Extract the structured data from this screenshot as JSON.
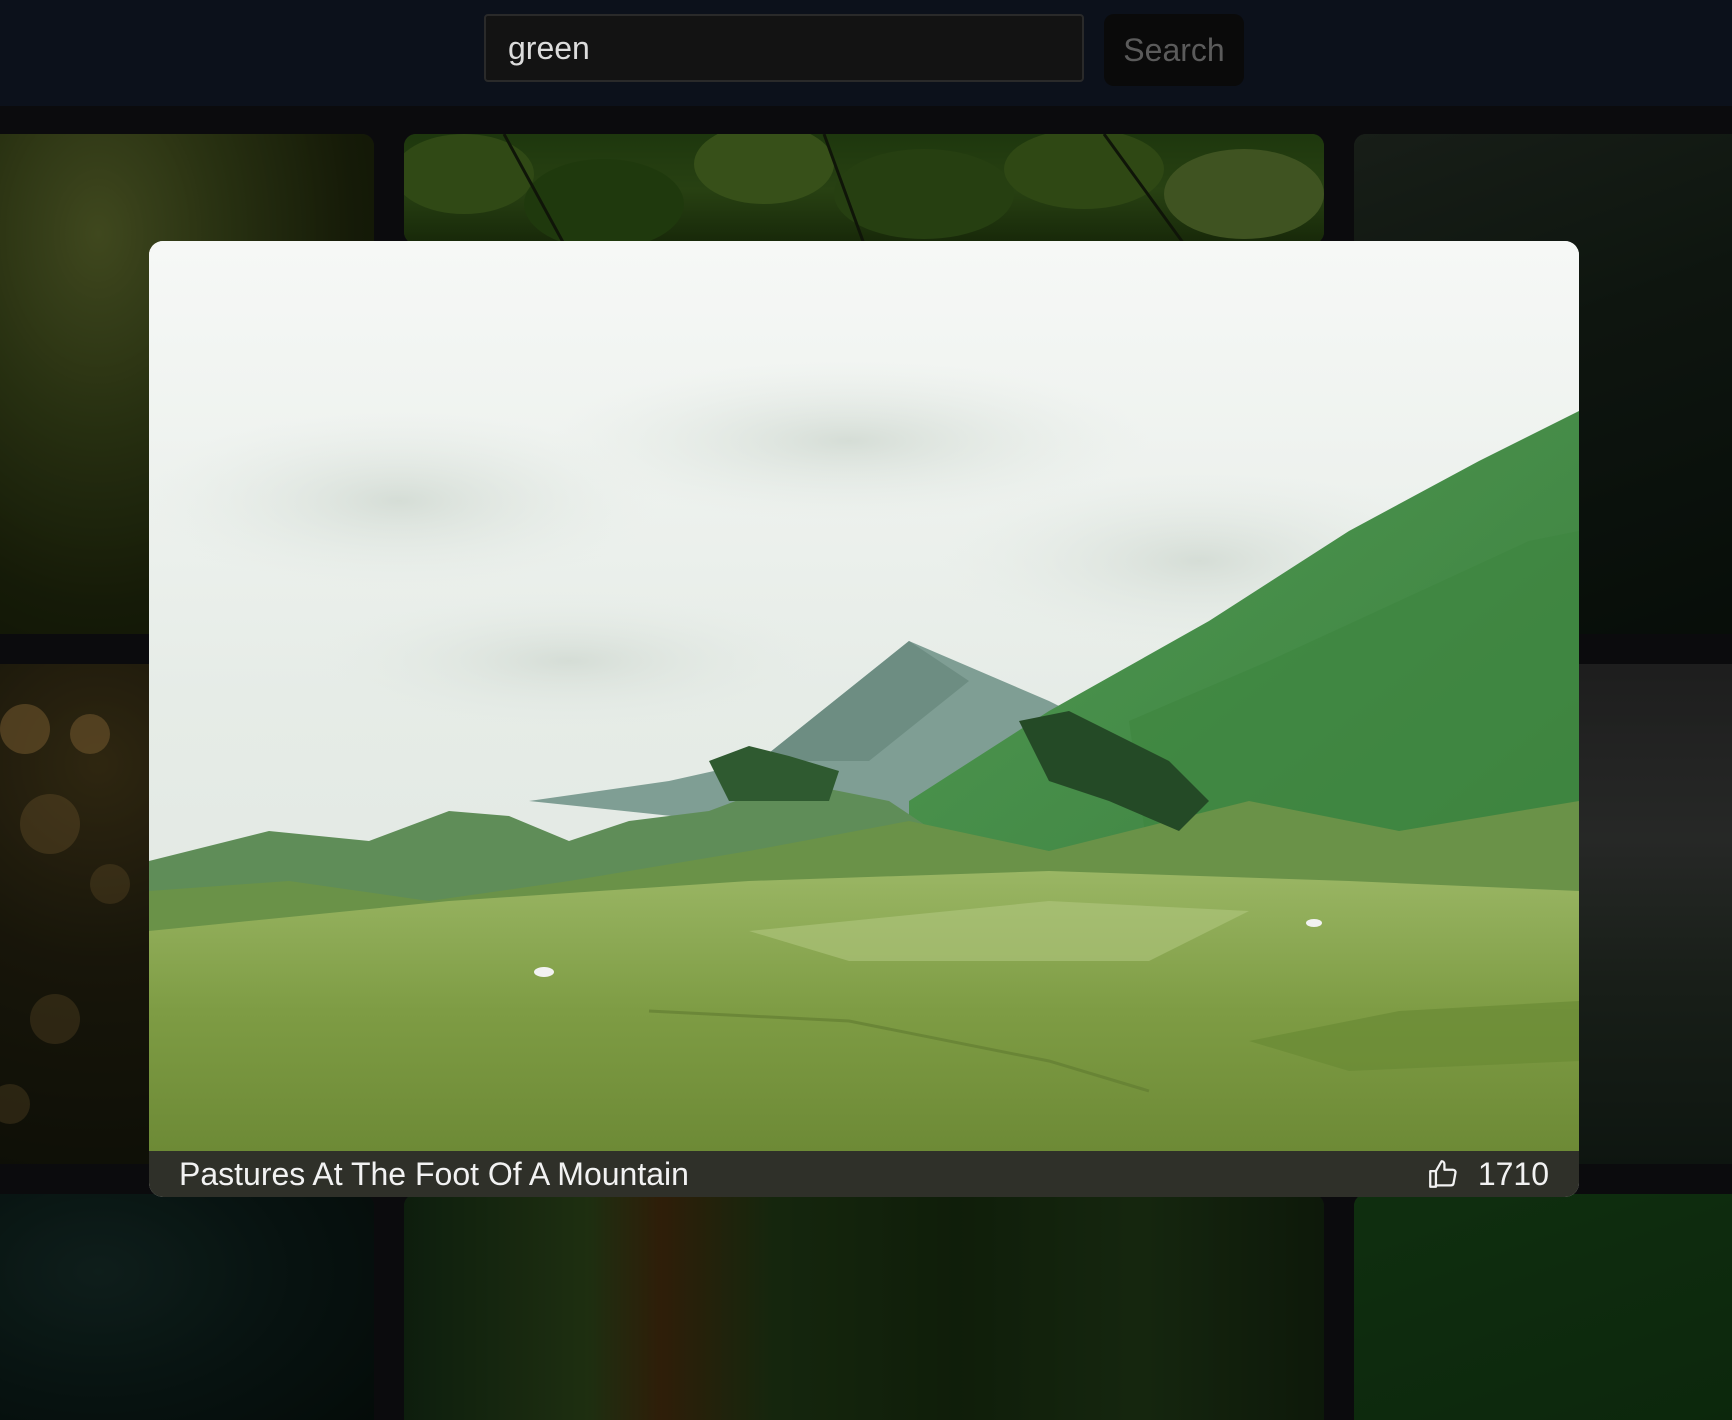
{
  "search": {
    "value": "green",
    "button_label": "Search"
  },
  "modal": {
    "title": "Pastures At The Foot Of A Mountain",
    "likes": "1710",
    "like_icon": "thumbs-up-icon"
  },
  "gallery": {
    "tiles": [
      "blurred-green-foliage",
      "green-leaves",
      "misty-forest",
      "bokeh-grass",
      "foggy-hills",
      "dark-teal-abstract",
      "painted-green-texture",
      "green-paper-texture"
    ]
  }
}
